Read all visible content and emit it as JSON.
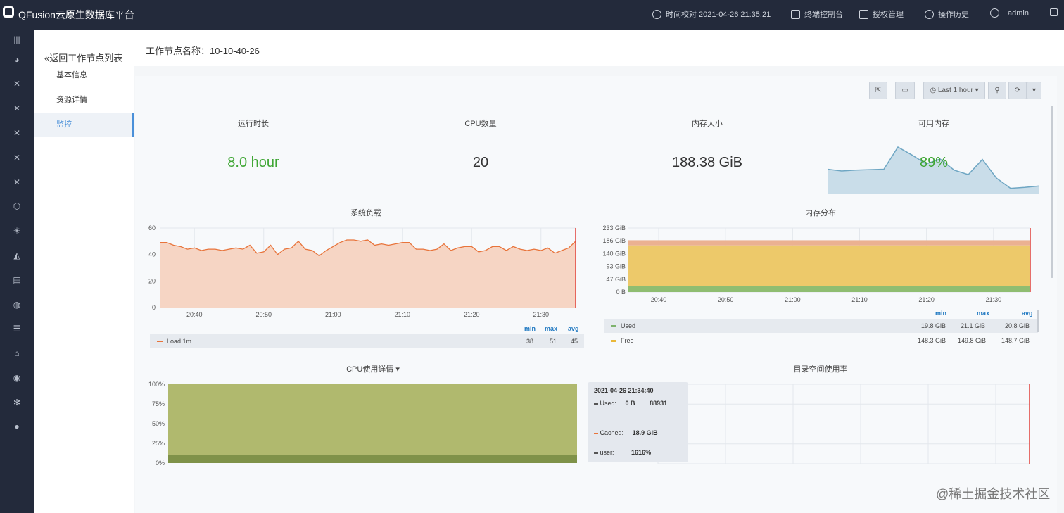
{
  "app": {
    "title": "QFusion云原生数据库平台"
  },
  "topbar": {
    "time": "时间校对 2021-04-26 21:35:21",
    "terminal": "终端控制台",
    "license": "授权管理",
    "history": "操作历史",
    "user": "admin",
    "icons": [
      "clock-icon",
      "terminal-icon",
      "layers-icon",
      "clock-icon",
      "user-icon",
      "logout-icon"
    ]
  },
  "sidebar": {
    "icons": [
      "menu-icon",
      "dashboard-icon",
      "topology-icon",
      "topology-icon",
      "topology-icon",
      "topology-icon",
      "topology-icon",
      "shield-icon",
      "cluster-icon",
      "bell-icon",
      "document-icon",
      "globe-icon",
      "list-icon",
      "car-icon",
      "antenna-icon",
      "settings-icon",
      "location-icon"
    ]
  },
  "subnav": {
    "back": "返回工作节点列表",
    "items": [
      "基本信息",
      "资源详情",
      "监控"
    ],
    "active": 2
  },
  "page": {
    "title": "工作节点名称：10-10-40-26"
  },
  "toolbar": {
    "time_range": "Last 1 hour",
    "icons": [
      "share-icon",
      "monitor-icon",
      "search-icon",
      "refresh-icon",
      "chevron-down-icon"
    ]
  },
  "stats": [
    {
      "label": "运行时长",
      "value": "8.0 hour",
      "color": "#3fa634"
    },
    {
      "label": "CPU数量",
      "value": "20",
      "color": "#333333"
    },
    {
      "label": "内存大小",
      "value": "188.38 GiB",
      "color": "#333333"
    },
    {
      "label": "可用内存",
      "value": "89%",
      "color": "#3fa634"
    }
  ],
  "panels": {
    "load": "系统负载",
    "mem": "内存分布",
    "cpu": "CPU使用详情",
    "disk": "目录空间使用率"
  },
  "legend_headers": {
    "min": "min",
    "max": "max",
    "avg": "avg"
  },
  "load_legend": {
    "name": "Load 1m",
    "min": "38",
    "max": "51",
    "avg": "45"
  },
  "mem_legend": [
    {
      "name": "Used",
      "min": "19.8 GiB",
      "max": "21.1 GiB",
      "avg": "20.8 GiB",
      "color": "#7eb26d"
    },
    {
      "name": "Free",
      "min": "148.3 GiB",
      "max": "149.8 GiB",
      "avg": "148.7 GiB",
      "color": "#eab839"
    }
  ],
  "tooltip": {
    "title": "2021-04-26 21:34:40",
    "rows": [
      {
        "label": "Used:",
        "value": "0 B",
        "extra": "88931"
      },
      {
        "label": "Cached:",
        "value": "18.9 GiB",
        "extra": ""
      },
      {
        "label": "user:",
        "value": "1616%",
        "extra": ""
      }
    ]
  },
  "watermark": "@稀土掘金技术社区",
  "chart_data": [
    {
      "type": "area",
      "title": "系统负载",
      "x": [
        "20:35",
        "20:36",
        "20:37",
        "20:38",
        "20:39",
        "20:40",
        "20:41",
        "20:42",
        "20:43",
        "20:44",
        "20:45",
        "20:46",
        "20:47",
        "20:48",
        "20:49",
        "20:50",
        "20:51",
        "20:52",
        "20:53",
        "20:54",
        "20:55",
        "20:56",
        "20:57",
        "20:58",
        "20:59",
        "21:00",
        "21:01",
        "21:02",
        "21:03",
        "21:04",
        "21:05",
        "21:06",
        "21:07",
        "21:08",
        "21:09",
        "21:10",
        "21:11",
        "21:12",
        "21:13",
        "21:14",
        "21:15",
        "21:16",
        "21:17",
        "21:18",
        "21:19",
        "21:20",
        "21:21",
        "21:22",
        "21:23",
        "21:24",
        "21:25",
        "21:26",
        "21:27",
        "21:28",
        "21:29",
        "21:30",
        "21:31",
        "21:32",
        "21:33",
        "21:34",
        "21:35"
      ],
      "series": [
        {
          "name": "Load 1m",
          "values": [
            49,
            49,
            47,
            46,
            44,
            45,
            43,
            44,
            44,
            43,
            44,
            45,
            44,
            47,
            41,
            42,
            47,
            40,
            44,
            45,
            50,
            44,
            43,
            39,
            43,
            46,
            49,
            51,
            51,
            50,
            51,
            47,
            48,
            47,
            48,
            49,
            49,
            44,
            44,
            43,
            44,
            48,
            43,
            45,
            46,
            46,
            42,
            43,
            46,
            46,
            43,
            46,
            44,
            43,
            44,
            43,
            45,
            41,
            43,
            45,
            50
          ]
        }
      ],
      "xticks": [
        "20:40",
        "20:50",
        "21:00",
        "21:10",
        "21:20",
        "21:30"
      ],
      "yticks": [
        "0",
        "20",
        "40",
        "60"
      ],
      "ylim": [
        0,
        60
      ],
      "color": "#e8743b"
    },
    {
      "type": "area",
      "title": "内存分布",
      "xticks": [
        "20:40",
        "20:50",
        "21:00",
        "21:10",
        "21:20",
        "21:30"
      ],
      "yticks": [
        "0 B",
        "47 GiB",
        "93 GiB",
        "140 GiB",
        "186 GiB",
        "233 GiB"
      ],
      "ylim": [
        0,
        233
      ],
      "stack_gib": {
        "Used": 20.8,
        "Free": 148.7,
        "Total": 188.4
      },
      "series_colors": {
        "Used": "#7eb26d",
        "Free": "#eab839",
        "Top": "#e5a06b"
      }
    },
    {
      "type": "area",
      "title": "CPU使用详情",
      "yticks": [
        "0%",
        "25%",
        "50%",
        "75%",
        "100%"
      ],
      "ylim": [
        0,
        100
      ],
      "fill_pct": 100,
      "lower_band_pct": 10,
      "color": "#b0b96e"
    },
    {
      "type": "line",
      "title": "可用内存",
      "series": [
        {
          "name": "",
          "values": [
            50,
            46,
            48,
            49,
            50,
            100,
            82,
            62,
            73,
            48,
            38,
            72,
            30,
            7,
            9,
            12
          ]
        }
      ],
      "ylim": [
        0,
        100
      ],
      "color": "#9ac0d6"
    }
  ]
}
